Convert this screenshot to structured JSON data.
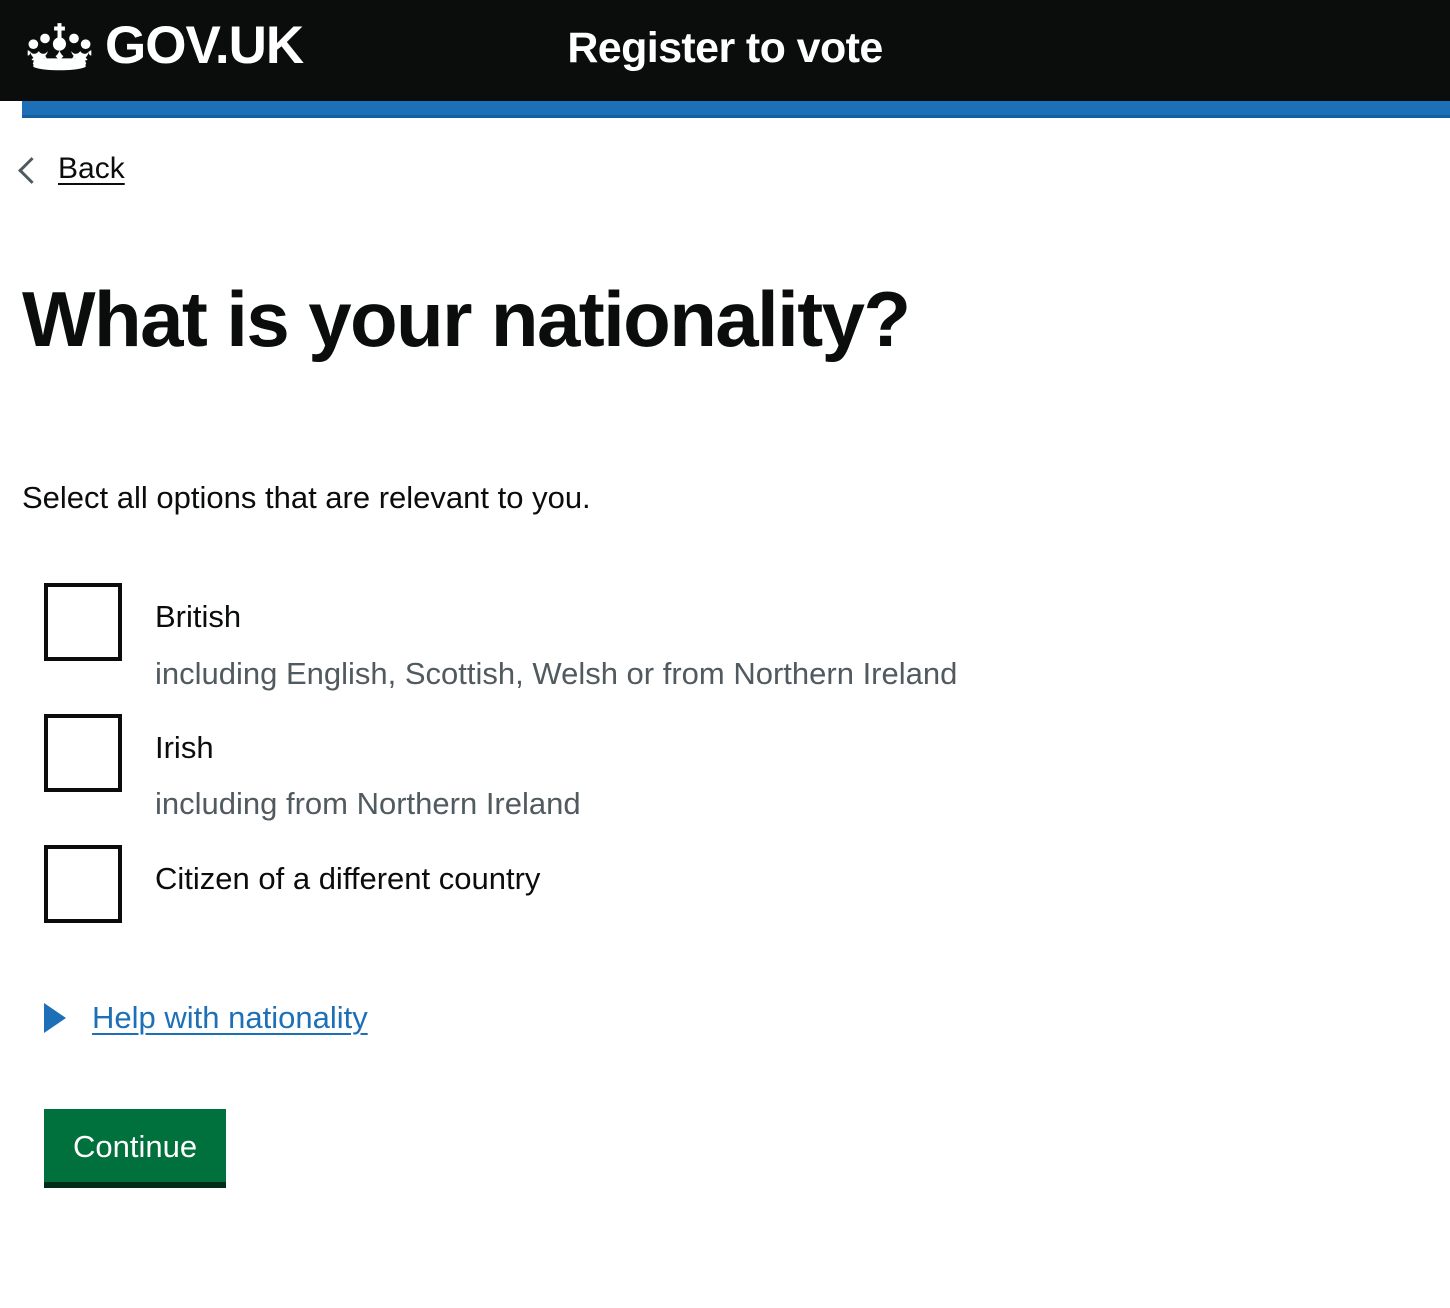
{
  "header": {
    "crown_icon": "govuk-crown-icon",
    "brand_name": "GOV.UK",
    "service_name": "Register to vote",
    "background_color": "#0b0c0c",
    "accent_color": "#1d70b8"
  },
  "back_link": {
    "icon": "chevron-left-icon",
    "label": "Back"
  },
  "main": {
    "heading": "What is your nationality?",
    "hint": "Select all options that are relevant to you.",
    "checkboxes": [
      {
        "label": "British",
        "hint": "including English, Scottish, Welsh or from Northern Ireland",
        "checked": false
      },
      {
        "label": "Irish",
        "hint": "including from Northern Ireland",
        "checked": false
      },
      {
        "label": "Citizen of a different country",
        "hint": "",
        "checked": false
      }
    ],
    "details": {
      "icon": "triangle-right-icon",
      "summary": "Help with nationality",
      "open": false,
      "link_color": "#1d70b8"
    },
    "continue_button": {
      "label": "Continue",
      "color": "#00703c",
      "shadow_color": "#002d18"
    }
  }
}
